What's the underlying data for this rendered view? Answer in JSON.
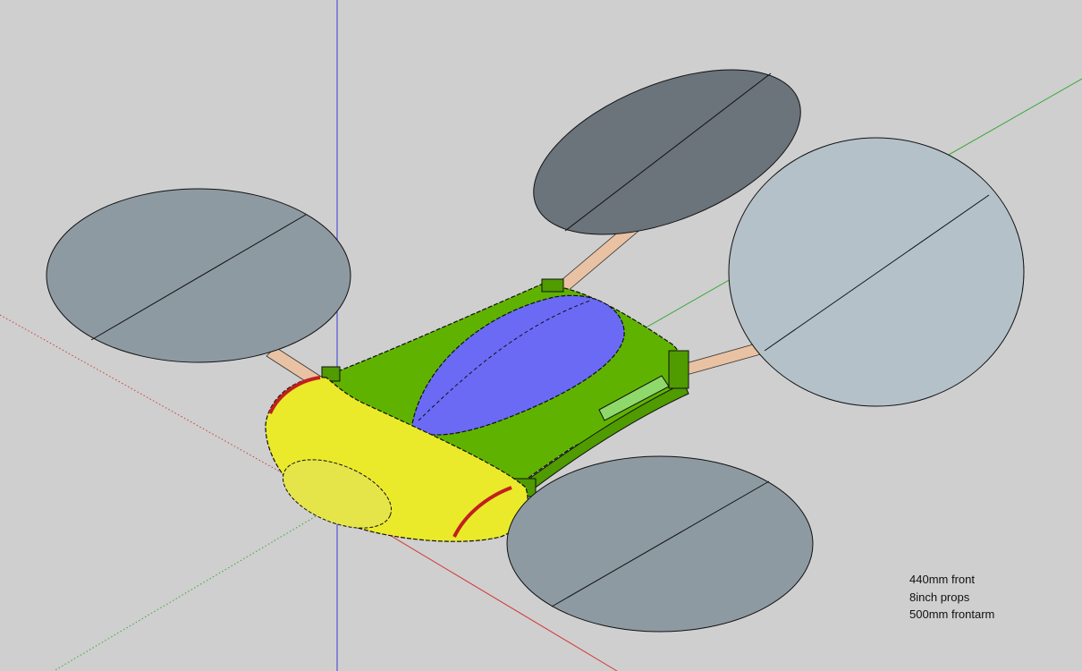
{
  "scene": {
    "background_color": "#cfcfcf",
    "colors": {
      "axis_blue": "#3b3bd6",
      "axis_red": "#d43b3b",
      "axis_green": "#3aa83a",
      "propeller_dark": "#6b737b",
      "propeller_mid": "#8e9aa2",
      "propeller_light": "#b4c1c9",
      "arm": "#e9c2a3",
      "body_green": "#5fb300",
      "front_yellow": "#eaea2a",
      "canopy_blue": "#6a6af5",
      "accent_red": "#c21f1f"
    },
    "objects": [
      "propeller-front-left",
      "propeller-rear-left",
      "propeller-rear-right",
      "propeller-front-right",
      "quadcopter-body",
      "canopy",
      "front-nose"
    ]
  },
  "annotation": {
    "lines": [
      "440mm front",
      "8inch props",
      "500mm frontarm"
    ]
  }
}
